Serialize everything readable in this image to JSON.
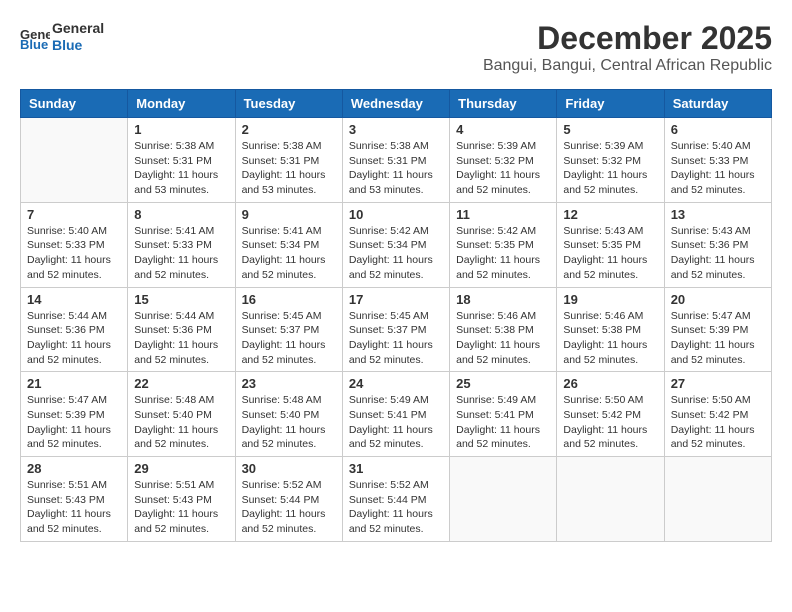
{
  "logo": {
    "line1": "General",
    "line2": "Blue"
  },
  "title": "December 2025",
  "subtitle": "Bangui, Bangui, Central African Republic",
  "days_of_week": [
    "Sunday",
    "Monday",
    "Tuesday",
    "Wednesday",
    "Thursday",
    "Friday",
    "Saturday"
  ],
  "weeks": [
    [
      {
        "day": "",
        "info": ""
      },
      {
        "day": "1",
        "info": "Sunrise: 5:38 AM\nSunset: 5:31 PM\nDaylight: 11 hours\nand 53 minutes."
      },
      {
        "day": "2",
        "info": "Sunrise: 5:38 AM\nSunset: 5:31 PM\nDaylight: 11 hours\nand 53 minutes."
      },
      {
        "day": "3",
        "info": "Sunrise: 5:38 AM\nSunset: 5:31 PM\nDaylight: 11 hours\nand 53 minutes."
      },
      {
        "day": "4",
        "info": "Sunrise: 5:39 AM\nSunset: 5:32 PM\nDaylight: 11 hours\nand 52 minutes."
      },
      {
        "day": "5",
        "info": "Sunrise: 5:39 AM\nSunset: 5:32 PM\nDaylight: 11 hours\nand 52 minutes."
      },
      {
        "day": "6",
        "info": "Sunrise: 5:40 AM\nSunset: 5:33 PM\nDaylight: 11 hours\nand 52 minutes."
      }
    ],
    [
      {
        "day": "7",
        "info": "Sunrise: 5:40 AM\nSunset: 5:33 PM\nDaylight: 11 hours\nand 52 minutes."
      },
      {
        "day": "8",
        "info": "Sunrise: 5:41 AM\nSunset: 5:33 PM\nDaylight: 11 hours\nand 52 minutes."
      },
      {
        "day": "9",
        "info": "Sunrise: 5:41 AM\nSunset: 5:34 PM\nDaylight: 11 hours\nand 52 minutes."
      },
      {
        "day": "10",
        "info": "Sunrise: 5:42 AM\nSunset: 5:34 PM\nDaylight: 11 hours\nand 52 minutes."
      },
      {
        "day": "11",
        "info": "Sunrise: 5:42 AM\nSunset: 5:35 PM\nDaylight: 11 hours\nand 52 minutes."
      },
      {
        "day": "12",
        "info": "Sunrise: 5:43 AM\nSunset: 5:35 PM\nDaylight: 11 hours\nand 52 minutes."
      },
      {
        "day": "13",
        "info": "Sunrise: 5:43 AM\nSunset: 5:36 PM\nDaylight: 11 hours\nand 52 minutes."
      }
    ],
    [
      {
        "day": "14",
        "info": "Sunrise: 5:44 AM\nSunset: 5:36 PM\nDaylight: 11 hours\nand 52 minutes."
      },
      {
        "day": "15",
        "info": "Sunrise: 5:44 AM\nSunset: 5:36 PM\nDaylight: 11 hours\nand 52 minutes."
      },
      {
        "day": "16",
        "info": "Sunrise: 5:45 AM\nSunset: 5:37 PM\nDaylight: 11 hours\nand 52 minutes."
      },
      {
        "day": "17",
        "info": "Sunrise: 5:45 AM\nSunset: 5:37 PM\nDaylight: 11 hours\nand 52 minutes."
      },
      {
        "day": "18",
        "info": "Sunrise: 5:46 AM\nSunset: 5:38 PM\nDaylight: 11 hours\nand 52 minutes."
      },
      {
        "day": "19",
        "info": "Sunrise: 5:46 AM\nSunset: 5:38 PM\nDaylight: 11 hours\nand 52 minutes."
      },
      {
        "day": "20",
        "info": "Sunrise: 5:47 AM\nSunset: 5:39 PM\nDaylight: 11 hours\nand 52 minutes."
      }
    ],
    [
      {
        "day": "21",
        "info": "Sunrise: 5:47 AM\nSunset: 5:39 PM\nDaylight: 11 hours\nand 52 minutes."
      },
      {
        "day": "22",
        "info": "Sunrise: 5:48 AM\nSunset: 5:40 PM\nDaylight: 11 hours\nand 52 minutes."
      },
      {
        "day": "23",
        "info": "Sunrise: 5:48 AM\nSunset: 5:40 PM\nDaylight: 11 hours\nand 52 minutes."
      },
      {
        "day": "24",
        "info": "Sunrise: 5:49 AM\nSunset: 5:41 PM\nDaylight: 11 hours\nand 52 minutes."
      },
      {
        "day": "25",
        "info": "Sunrise: 5:49 AM\nSunset: 5:41 PM\nDaylight: 11 hours\nand 52 minutes."
      },
      {
        "day": "26",
        "info": "Sunrise: 5:50 AM\nSunset: 5:42 PM\nDaylight: 11 hours\nand 52 minutes."
      },
      {
        "day": "27",
        "info": "Sunrise: 5:50 AM\nSunset: 5:42 PM\nDaylight: 11 hours\nand 52 minutes."
      }
    ],
    [
      {
        "day": "28",
        "info": "Sunrise: 5:51 AM\nSunset: 5:43 PM\nDaylight: 11 hours\nand 52 minutes."
      },
      {
        "day": "29",
        "info": "Sunrise: 5:51 AM\nSunset: 5:43 PM\nDaylight: 11 hours\nand 52 minutes."
      },
      {
        "day": "30",
        "info": "Sunrise: 5:52 AM\nSunset: 5:44 PM\nDaylight: 11 hours\nand 52 minutes."
      },
      {
        "day": "31",
        "info": "Sunrise: 5:52 AM\nSunset: 5:44 PM\nDaylight: 11 hours\nand 52 minutes."
      },
      {
        "day": "",
        "info": ""
      },
      {
        "day": "",
        "info": ""
      },
      {
        "day": "",
        "info": ""
      }
    ]
  ]
}
